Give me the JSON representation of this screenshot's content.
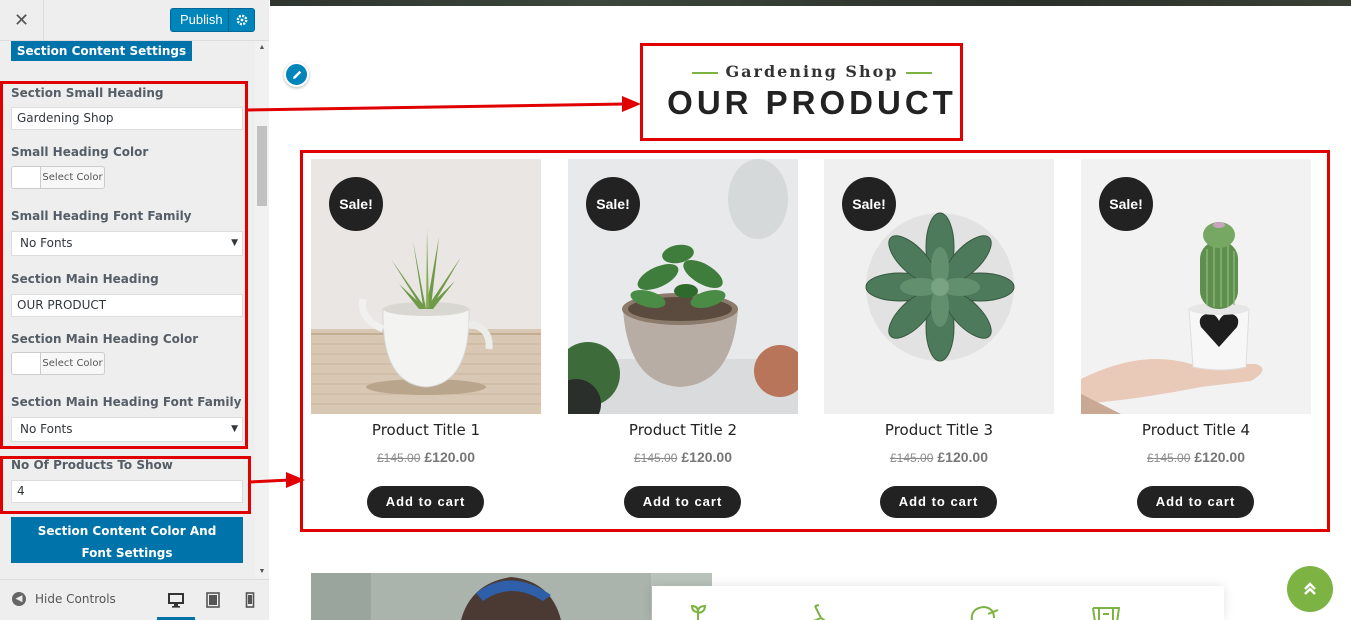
{
  "customizer": {
    "publish_label": "Publish",
    "section_header": "Section Content Settings",
    "fields": {
      "small_heading_label": "Section Small Heading",
      "small_heading_value": "Gardening Shop",
      "small_heading_color_label": "Small Heading Color",
      "select_color": "Select Color",
      "small_heading_font_label": "Small Heading Font Family",
      "font_value": "No Fonts",
      "main_heading_label": "Section Main Heading",
      "main_heading_value": "OUR PRODUCT",
      "main_heading_color_label": "Section Main Heading Color",
      "main_heading_font_label": "Section Main Heading Font Family",
      "products_count_label": "No Of Products To Show",
      "products_count_value": "4"
    },
    "color_font_button": "Section Content Color And Font Settings",
    "hide_controls": "Hide Controls"
  },
  "preview": {
    "small_heading": "Gardening Shop",
    "main_heading": "OUR PRODUCT",
    "products": [
      {
        "title": "Product Title 1",
        "old_price": "£145.00",
        "price": "£120.00",
        "badge": "Sale!",
        "cart": "Add to cart"
      },
      {
        "title": "Product Title 2",
        "old_price": "£145.00",
        "price": "£120.00",
        "badge": "Sale!",
        "cart": "Add to cart"
      },
      {
        "title": "Product Title 3",
        "old_price": "£145.00",
        "price": "£120.00",
        "badge": "Sale!",
        "cart": "Add to cart"
      },
      {
        "title": "Product Title 4",
        "old_price": "£145.00",
        "price": "£120.00",
        "badge": "Sale!",
        "cart": "Add to cart"
      }
    ]
  },
  "icons": [
    "close-icon",
    "gear-icon",
    "edit-pencil-icon",
    "hide-controls-icon",
    "desktop-icon",
    "tablet-icon",
    "mobile-icon",
    "scroll-top-icon",
    "sprout-icon",
    "watering-can-icon",
    "leaf-icon",
    "trophy-icon"
  ],
  "colors": {
    "wp_blue": "#0073aa",
    "accent_green": "#7cb342",
    "annotation_red": "#e00000",
    "dark": "#222222"
  }
}
